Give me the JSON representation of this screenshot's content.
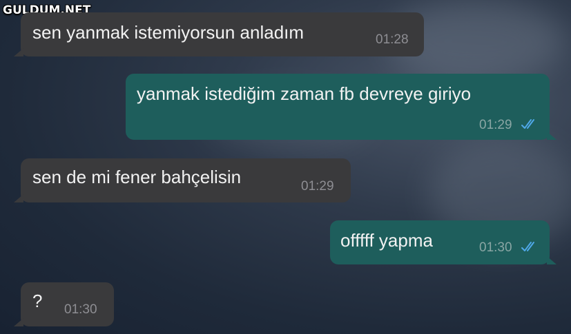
{
  "watermark": "GULDUM.NET",
  "messages": [
    {
      "direction": "incoming",
      "text": "sen yanmak istemiyorsun anladım",
      "time": "01:28"
    },
    {
      "direction": "outgoing",
      "text": "yanmak istediğim zaman fb devreye giriyo",
      "time": "01:29",
      "status": "read-ticks-icon"
    },
    {
      "direction": "incoming",
      "text": "sen de mi fener bahçelisin",
      "time": "01:29"
    },
    {
      "direction": "outgoing",
      "text": "offfff yapma",
      "time": "01:30",
      "status": "read-ticks-icon"
    },
    {
      "direction": "incoming",
      "text": "?",
      "time": "01:30"
    }
  ],
  "colors": {
    "incoming_bubble": "#3a3a3c",
    "outgoing_bubble": "#1e5e5c",
    "read_ticks": "#4fa8e8"
  }
}
